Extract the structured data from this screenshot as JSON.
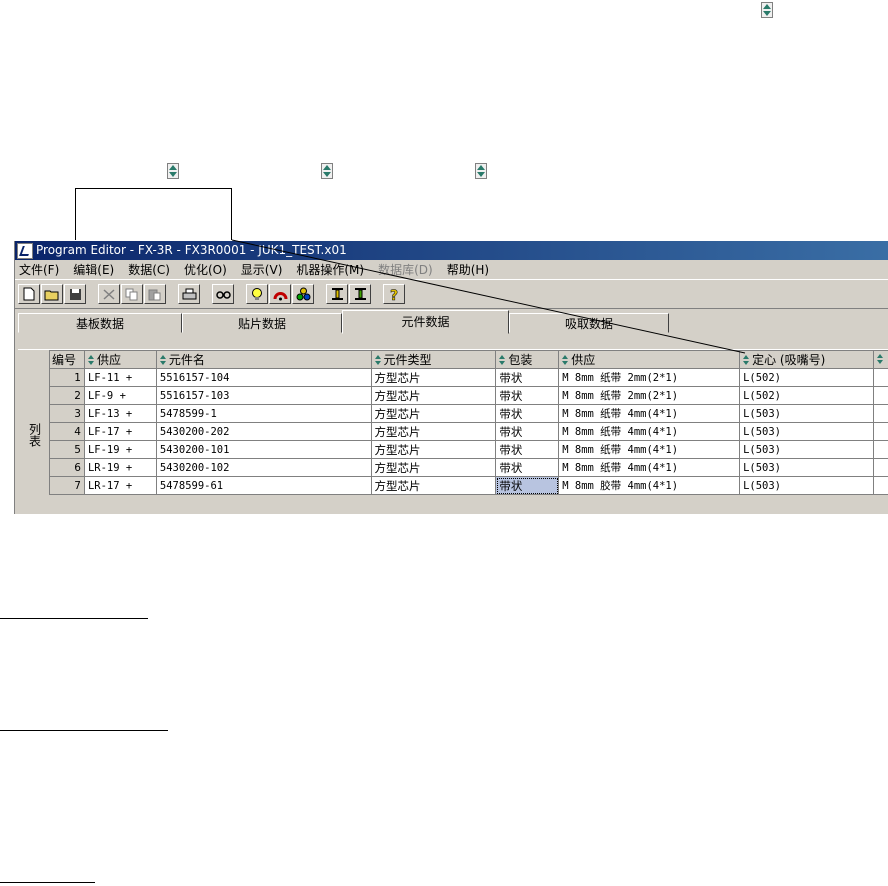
{
  "window": {
    "title": "Program Editor - FX-3R - FX3R0001 - JUK1_TEST.x01"
  },
  "menubar": {
    "items": [
      "文件(F)",
      "编辑(E)",
      "数据(C)",
      "优化(O)",
      "显示(V)",
      "机器操作(M)",
      "数据库(D)",
      "帮助(H)"
    ]
  },
  "tabs": [
    "基板数据",
    "贴片数据",
    "元件数据",
    "吸取数据"
  ],
  "sidebar_label": "列表",
  "table": {
    "headers": [
      "编号",
      "供应",
      "元件名",
      "元件类型",
      "包装",
      "供应",
      "定心 (吸嘴号)"
    ],
    "rows": [
      {
        "no": "1",
        "feed": "LF-11 +",
        "part": "5516157-104",
        "type": "方型芯片",
        "pack": "带状",
        "supply": "M 8mm 纸带 2mm(2*1)",
        "center": "L(502)"
      },
      {
        "no": "2",
        "feed": "LF-9 +",
        "part": "5516157-103",
        "type": "方型芯片",
        "pack": "带状",
        "supply": "M 8mm 纸带 2mm(2*1)",
        "center": "L(502)"
      },
      {
        "no": "3",
        "feed": "LF-13 +",
        "part": "5478599-1",
        "type": "方型芯片",
        "pack": "带状",
        "supply": "M 8mm 纸带 4mm(4*1)",
        "center": "L(503)"
      },
      {
        "no": "4",
        "feed": "LF-17 +",
        "part": "5430200-202",
        "type": "方型芯片",
        "pack": "带状",
        "supply": "M 8mm 纸带 4mm(4*1)",
        "center": "L(503)"
      },
      {
        "no": "5",
        "feed": "LF-19 +",
        "part": "5430200-101",
        "type": "方型芯片",
        "pack": "带状",
        "supply": "M 8mm 纸带 4mm(4*1)",
        "center": "L(503)"
      },
      {
        "no": "6",
        "feed": "LR-19 +",
        "part": "5430200-102",
        "type": "方型芯片",
        "pack": "带状",
        "supply": "M 8mm 纸带 4mm(4*1)",
        "center": "L(503)"
      },
      {
        "no": "7",
        "feed": "LR-17 +",
        "part": "5478599-61",
        "type": "方型芯片",
        "pack": "带状",
        "supply": "M 8mm 胶带 4mm(4*1)",
        "center": "L(503)"
      }
    ]
  },
  "colors": {
    "titlebar": "#0a246a",
    "face": "#d4d0c8",
    "selection": "#b8c4e0"
  },
  "icons": [
    "sort-arrows-icon",
    "new-file-icon",
    "open-folder-icon",
    "save-icon",
    "cut-icon",
    "copy-icon",
    "paste-icon",
    "print-icon",
    "find-icon",
    "light-bulb-icon",
    "optimize-icon",
    "database-icon",
    "transfer-icon",
    "help-icon"
  ]
}
